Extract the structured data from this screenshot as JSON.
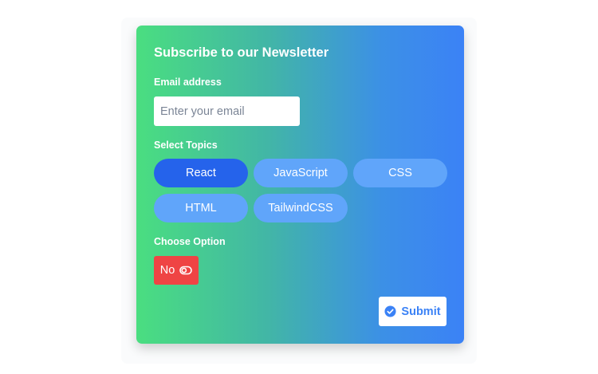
{
  "form": {
    "title": "Subscribe to our Newsletter",
    "email_label": "Email address",
    "email_placeholder": "Enter your email",
    "email_value": "",
    "topics_label": "Select Topics",
    "topics": [
      {
        "label": "React",
        "selected": true
      },
      {
        "label": "JavaScript",
        "selected": false
      },
      {
        "label": "CSS",
        "selected": false
      },
      {
        "label": "HTML",
        "selected": false
      },
      {
        "label": "TailwindCSS",
        "selected": false
      }
    ],
    "option_label": "Choose Option",
    "toggle": {
      "label": "No",
      "icon": "toggle-off-icon",
      "color": "#ef4444"
    },
    "submit": {
      "label": "Submit",
      "icon": "check-circle-icon"
    }
  },
  "colors": {
    "gradient_start": "#4ade80",
    "gradient_end": "#3b82f6",
    "pill_default": "#60a5fa",
    "pill_selected": "#2563eb",
    "submit_text": "#3b82f6"
  }
}
